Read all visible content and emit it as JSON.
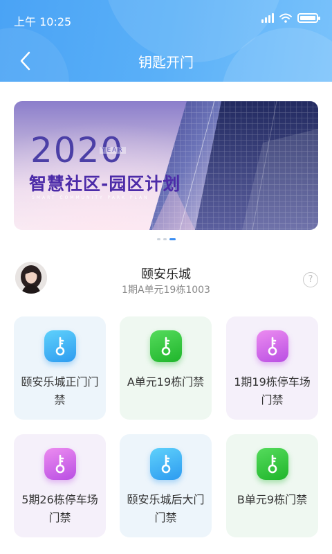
{
  "status_bar": {
    "time": "上午 10:25"
  },
  "header": {
    "title": "钥匙开门"
  },
  "banner": {
    "year": "2020",
    "year_tag": "YEAR",
    "title": "智慧社区-园区计划",
    "subtitle": "SMART COMMUNITY PARK PLAN",
    "page_count": 3,
    "active_page": 3
  },
  "profile": {
    "community_name": "颐安乐城",
    "unit": "1期A单元19栋1003",
    "help_icon": "?"
  },
  "doors": [
    {
      "label": "颐安乐城正门门禁",
      "color": "blue",
      "icon": "key-icon"
    },
    {
      "label": "A单元19栋门禁",
      "color": "green",
      "icon": "key-icon"
    },
    {
      "label": "1期19栋停车场门禁",
      "color": "purple",
      "icon": "key-icon"
    },
    {
      "label": "5期26栋停车场门禁",
      "color": "purple",
      "icon": "key-icon"
    },
    {
      "label": "颐安乐城后大门门禁",
      "color": "blue",
      "icon": "key-icon"
    },
    {
      "label": "B单元9栋门禁",
      "color": "green",
      "icon": "key-icon"
    }
  ],
  "colors": {
    "header_start": "#4aa3f5",
    "accent_blue": "#2d9bf0",
    "accent_green": "#1fb52b",
    "accent_purple": "#b94ee3"
  }
}
